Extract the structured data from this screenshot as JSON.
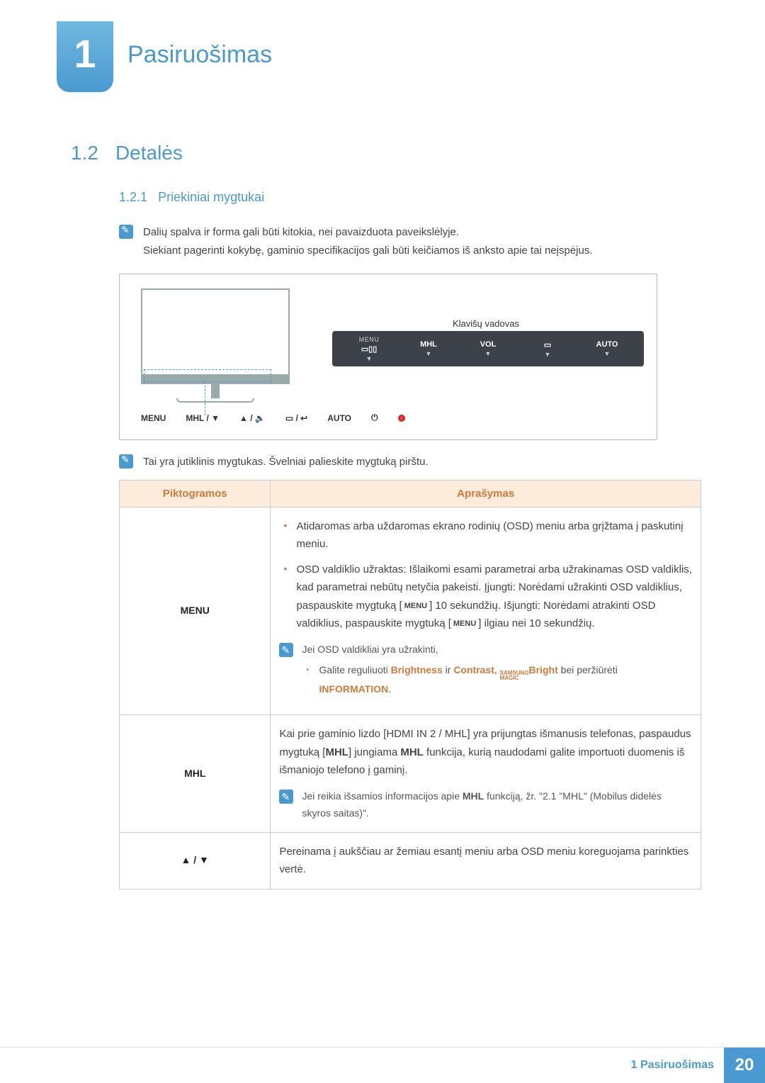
{
  "chapter": {
    "num": "1",
    "title": "Pasiruošimas"
  },
  "section": {
    "num": "1.2",
    "title": "Detalės"
  },
  "subsection": {
    "num": "1.2.1",
    "title": "Priekiniai mygtukai"
  },
  "notes": {
    "n1": "Dalių spalva ir forma gali būti kitokia, nei pavaizduota paveikslėlyje.",
    "n2": "Siekiant pagerinti kokybę, gaminio specifikacijos gali būti keičiamos iš anksto apie tai neįspėjus.",
    "n3": "Tai yra jutiklinis mygtukas. Švelniai palieskite mygtuką pirštu."
  },
  "diagram": {
    "kv_label": "Klavišų vadovas",
    "osd": {
      "menu_top": "MENU",
      "menu_icon": "⎘",
      "mhl": "MHL",
      "vol": "VOL",
      "src": "▭",
      "auto": "AUTO"
    },
    "buttons": {
      "menu": "MENU",
      "mhl": "MHL / ▼",
      "vol": "▲ / 🔈",
      "src": "▭ / ↩",
      "auto": "AUTO",
      "power": "⏻"
    }
  },
  "table": {
    "h1": "Piktogramos",
    "h2": "Aprašymas",
    "row_menu": {
      "label": "MENU",
      "b1": "Atidaromas arba uždaromas ekrano rodinių (OSD) meniu arba grįžtama į paskutinį meniu.",
      "b2a": "OSD valdiklio užraktas: Išlaikomi esami parametrai arba užrakinamas OSD valdiklis, kad parametrai nebūtų netyčia pakeisti. Įjungti: Norėdami užrakinti OSD valdiklius, paspauskite mygtuką [",
      "b2_menu1": "MENU",
      "b2b": "] 10 sekundžių. Išjungti: Norėdami atrakinti OSD valdiklius, paspauskite mygtuką [",
      "b2_menu2": "MENU",
      "b2c": "] ilgiau nei 10 sekundžių.",
      "inner_head": "Jei OSD valdikliai yra užrakinti,",
      "inner_b_a": "Galite reguliuoti ",
      "inner_b_brightness": "Brightness",
      "inner_b_ir": " ir ",
      "inner_b_contrast": "Contrast",
      "inner_b_comma": ", ",
      "inner_b_magic_top": "SAMSUNG",
      "inner_b_magic_bot": "MAGIC",
      "inner_b_bright": "Bright",
      "inner_b_bei": " bei peržiūrėti ",
      "inner_b_info": "INFORMATION",
      "inner_b_dot": "."
    },
    "row_mhl": {
      "label": "MHL",
      "p1a": "Kai prie gaminio lizdo [HDMI IN 2 / MHL] yra prijungtas išmanusis telefonas, paspaudus mygtuką [",
      "p1b": "MHL",
      "p1c": "] jungiama ",
      "p1d": "MHL",
      "p1e": " funkcija, kurią naudodami galite importuoti duomenis iš išmaniojo telefono į gaminį.",
      "inner_a": "Jei reikia išsamios informacijos apie ",
      "inner_b": "MHL",
      "inner_c": " funkciją, žr. \"2.1 \"MHL\" (Mobilus didelės skyros saitas)\"."
    },
    "row_arrows": {
      "label": "▲ / ▼",
      "p": "Pereinama į aukščiau ar žemiau esantį meniu arba OSD meniu koreguojama parinkties vertė."
    }
  },
  "footer": {
    "text": "1 Pasiruošimas",
    "page": "20"
  }
}
